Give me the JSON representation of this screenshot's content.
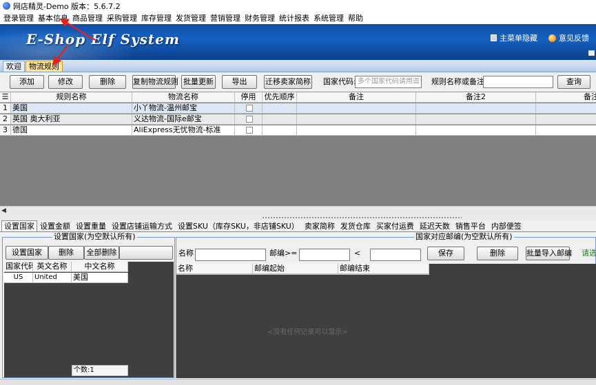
{
  "window": {
    "title": "网店精灵-Demo  版本：5.6.7.2"
  },
  "menubar": [
    "登录管理",
    "基本信息",
    "商品管理",
    "采购管理",
    "库存管理",
    "发货管理",
    "营销管理",
    "财务管理",
    "统计报表",
    "系统管理",
    "帮助"
  ],
  "banner": {
    "logo": "E-Shop Elf System",
    "menu_hide": "主菜单隐藏",
    "feedback": "意见反馈"
  },
  "doc_tabs": [
    {
      "label": "欢迎",
      "active": false
    },
    {
      "label": "物流规则",
      "active": true
    }
  ],
  "toolbar": {
    "add": "添加",
    "edit": "修改",
    "delete": "删除",
    "copy_rule": "复制物流规则",
    "batch_update": "批量更新",
    "export": "导出",
    "migrate": "迁移卖家简称",
    "country_code_label": "国家代码:",
    "country_code_placeholder": "多个国家代码请用逗号",
    "rule_search_label": "规则名称或备注:",
    "rule_search_value": "",
    "query": "查询"
  },
  "grid": {
    "columns": [
      "规则名称",
      "物流名称",
      "停用",
      "优先顺序",
      "备注",
      "备注2",
      "备注"
    ],
    "rows": [
      {
        "no": "1",
        "rule": "美国",
        "logistics": "小丫物流-温州邮宝",
        "disabled": false,
        "priority": "",
        "note": "",
        "note2": ""
      },
      {
        "no": "2",
        "rule": "英国 奥大利亚",
        "logistics": "义达物流-国际e邮宝",
        "disabled": false,
        "priority": "",
        "note": "",
        "note2": ""
      },
      {
        "no": "3",
        "rule": "德国",
        "logistics": "AliExpress无忧物流-标准",
        "disabled": false,
        "priority": "",
        "note": "",
        "note2": ""
      }
    ]
  },
  "sub_tabs": [
    {
      "label": "设置国家",
      "active": true
    },
    {
      "label": "设置金额"
    },
    {
      "label": "设置重量"
    },
    {
      "label": "设置店铺运输方式"
    },
    {
      "label": "设置SKU（库存SKU，非店铺SKU）"
    },
    {
      "label": "卖家简称"
    },
    {
      "label": "发货仓库"
    },
    {
      "label": "买家付运费"
    },
    {
      "label": "延迟天数"
    },
    {
      "label": "销售平台"
    },
    {
      "label": "内部便签"
    }
  ],
  "country_panel": {
    "title": "设置国家(为空默认所有)",
    "set_country": "设置国家",
    "delete": "删除",
    "delete_all": "全部删除",
    "columns": [
      "国家代码",
      "英文名称",
      "中文名称"
    ],
    "rows": [
      {
        "code": "US",
        "en": "United",
        "cn": "美国"
      }
    ],
    "count": "个数:1"
  },
  "postcode_panel": {
    "title": "国家对应邮编(为空默认所有)",
    "name_label": "名称",
    "postcode_ge_label": "邮编>=",
    "lt_label": "<",
    "name_value": "",
    "postcode_from": "",
    "postcode_to": "",
    "save": "保存",
    "delete": "删除",
    "batch_import": "批量导入邮编",
    "hint": "请选",
    "columns": [
      "名称",
      "邮编起始",
      "邮编结束"
    ],
    "empty": "<没有任何记录可以显示>"
  },
  "colors": {
    "banner": "#1561c1",
    "active_tab": "#ffe7a3",
    "group_border": "#6f9bd3",
    "grid_bg": "#808080",
    "annotation_arrow": "#e8201c"
  }
}
